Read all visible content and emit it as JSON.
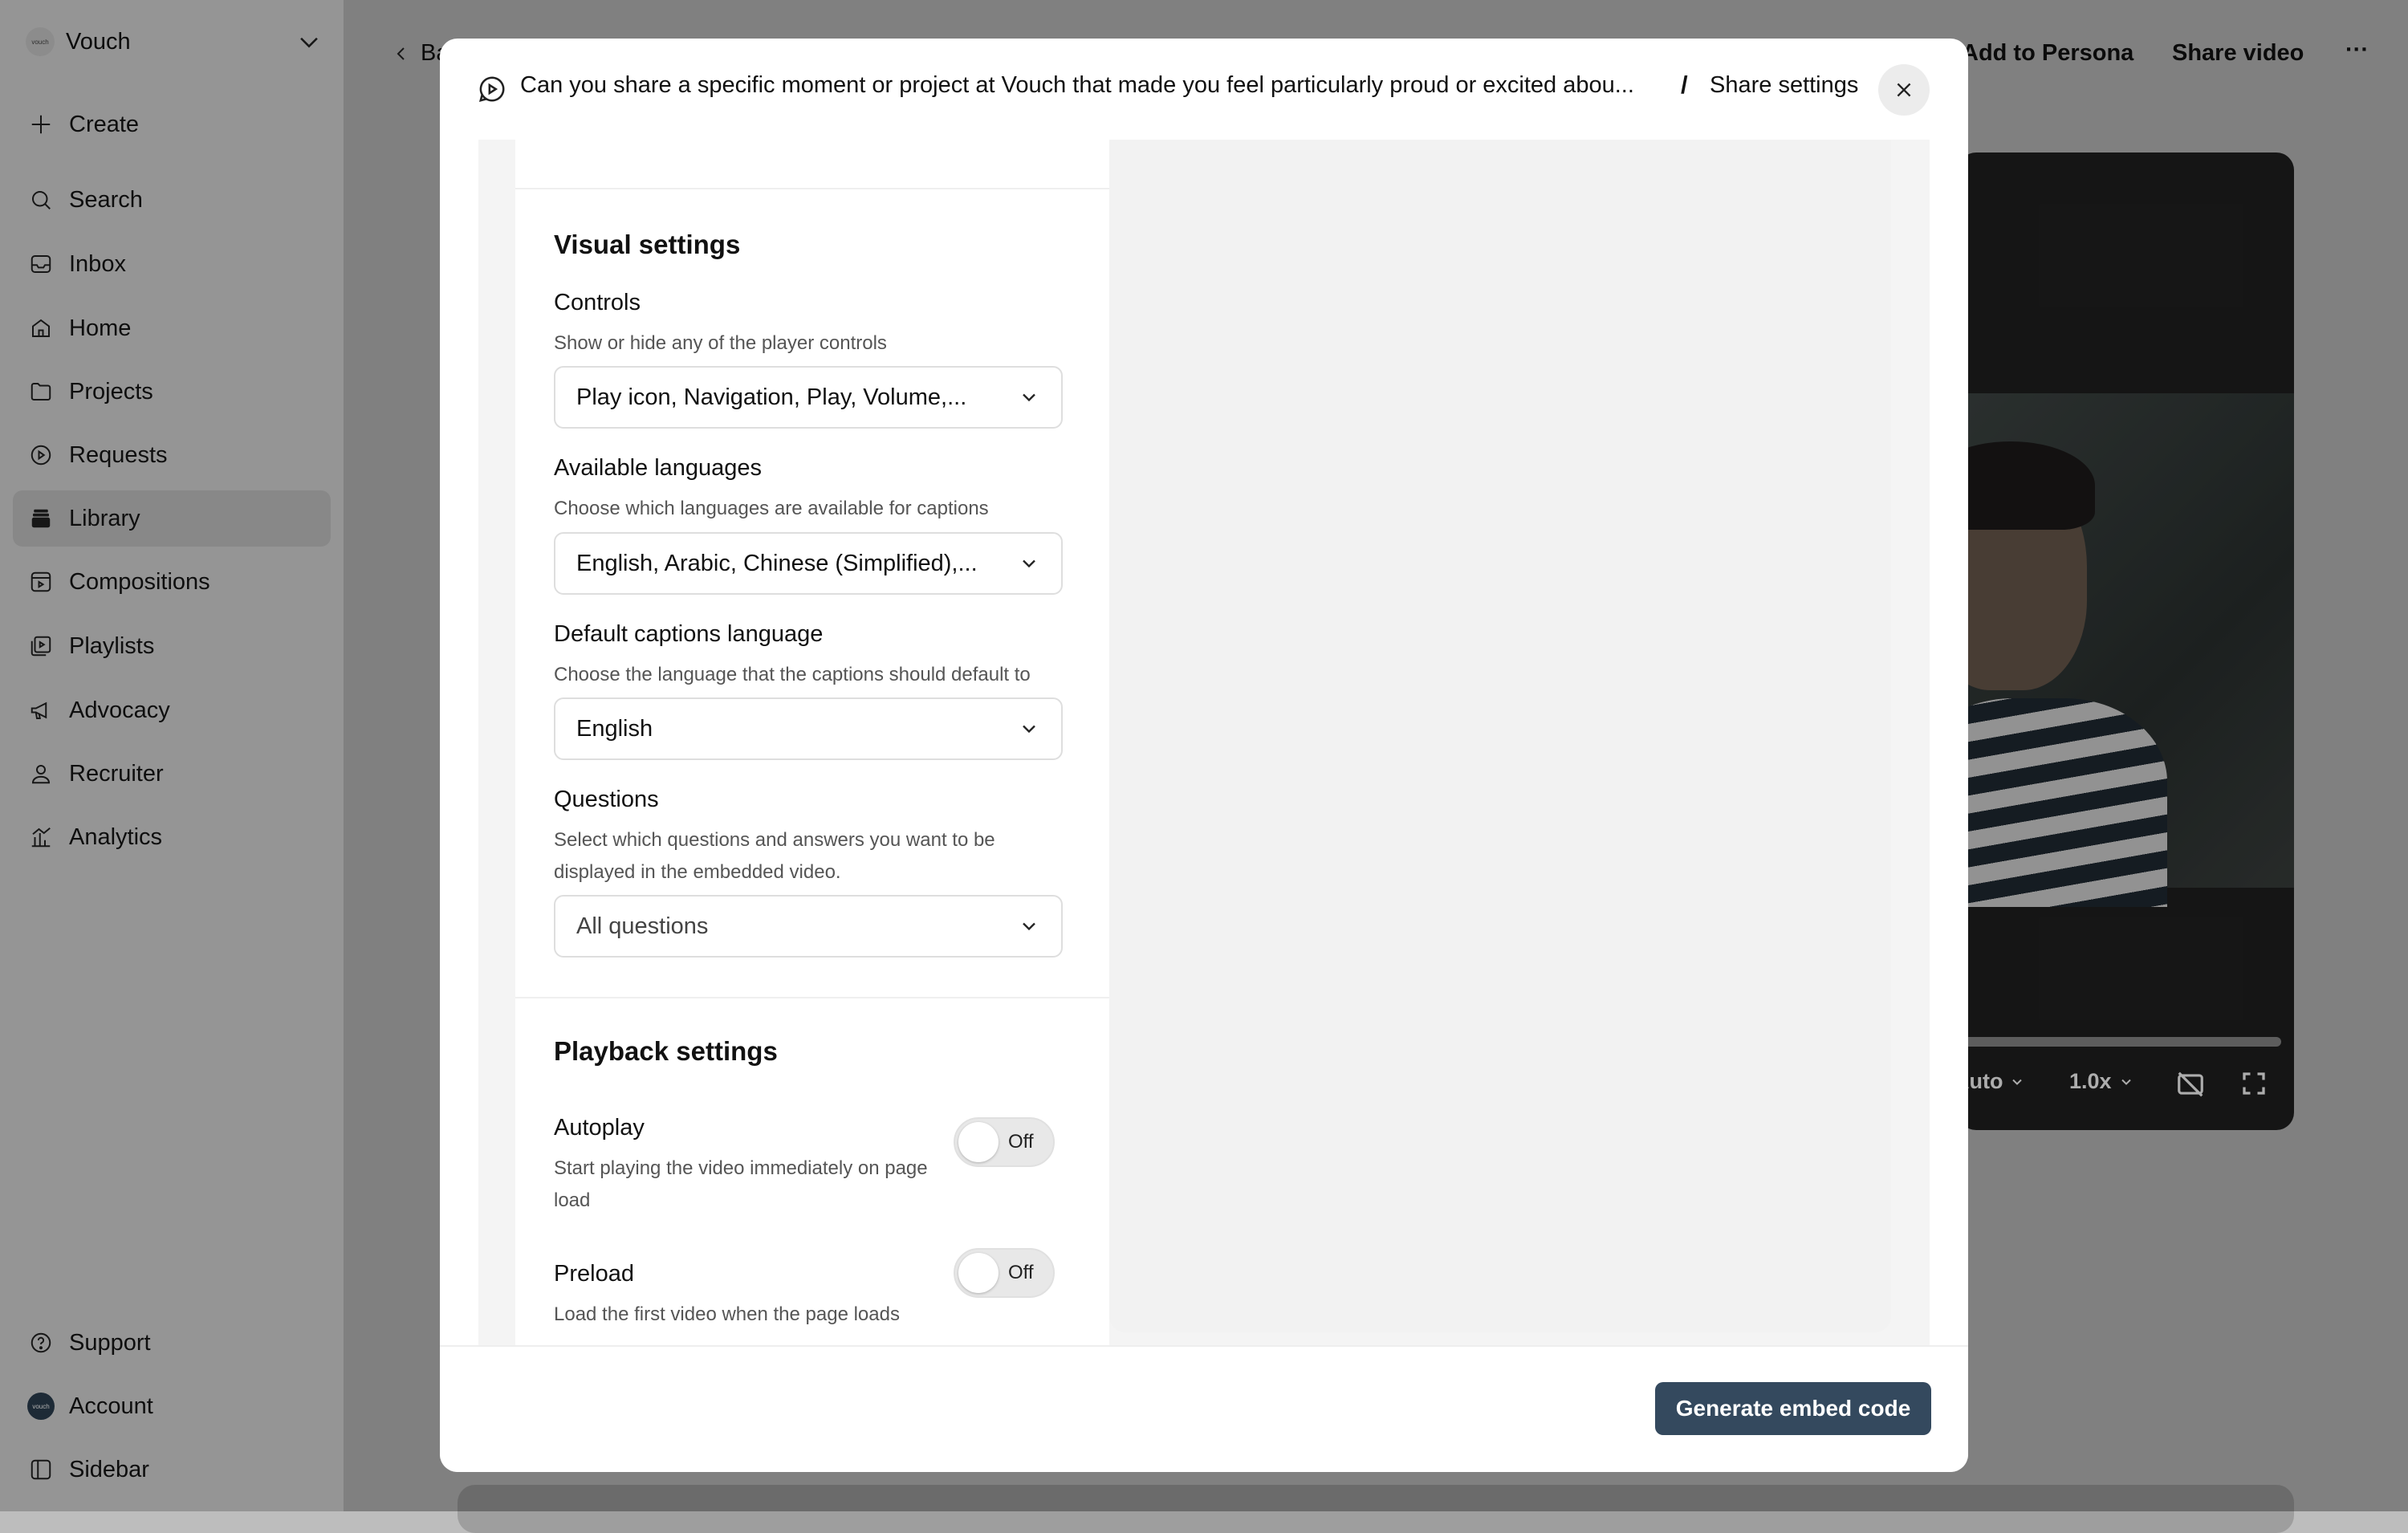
{
  "sidebar": {
    "workspace": {
      "name": "Vouch",
      "logo_text": "vouch"
    },
    "nav": [
      {
        "label": "Create",
        "icon": "plus-icon"
      },
      {
        "label": "Search",
        "icon": "search-icon"
      },
      {
        "label": "Inbox",
        "icon": "inbox-icon"
      },
      {
        "label": "Home",
        "icon": "home-icon"
      },
      {
        "label": "Projects",
        "icon": "folder-icon"
      },
      {
        "label": "Requests",
        "icon": "request-icon"
      },
      {
        "label": "Library",
        "icon": "library-icon",
        "active": true
      },
      {
        "label": "Compositions",
        "icon": "compositions-icon"
      },
      {
        "label": "Playlists",
        "icon": "playlists-icon"
      },
      {
        "label": "Advocacy",
        "icon": "megaphone-icon"
      },
      {
        "label": "Recruiter",
        "icon": "recruiter-icon"
      },
      {
        "label": "Analytics",
        "icon": "analytics-icon"
      }
    ],
    "bottom": [
      {
        "label": "Support",
        "icon": "help-icon"
      },
      {
        "label": "Account",
        "icon": "avatar"
      },
      {
        "label": "Sidebar",
        "icon": "sidebar-icon"
      }
    ]
  },
  "topbar": {
    "back_label": "Ba",
    "add_to_persona": "Add to Persona",
    "share_video": "Share video",
    "more": "···"
  },
  "video_player": {
    "quality": "Auto",
    "speed": "1.0x"
  },
  "modal": {
    "question": "Can you share a specific moment or project at Vouch that made you feel particularly proud or excited abou...",
    "separator": "/",
    "breadcrumb": "Share settings",
    "visual_settings": {
      "title": "Visual settings",
      "controls": {
        "label": "Controls",
        "help": "Show or hide any of the player controls",
        "value": "Play icon, Navigation, Play, Volume,..."
      },
      "languages": {
        "label": "Available languages",
        "help": "Choose which languages are available for captions",
        "value": "English, Arabic, Chinese (Simplified),..."
      },
      "default_captions": {
        "label": "Default captions language",
        "help": "Choose the language that the captions should default to",
        "value": "English"
      },
      "questions": {
        "label": "Questions",
        "help": "Select which questions and answers you want to be displayed in the embedded video.",
        "value": "All questions"
      }
    },
    "playback_settings": {
      "title": "Playback settings",
      "autoplay": {
        "label": "Autoplay",
        "help": "Start playing the video immediately on page load",
        "state": "Off"
      },
      "preload": {
        "label": "Preload",
        "help": "Load the first video when the page loads",
        "state": "Off"
      }
    },
    "generate_button": "Generate embed code"
  },
  "colors": {
    "primary_button": "#34495e",
    "sidebar_bg": "#dcdcdc",
    "overlay": "rgba(0,0,0,0.32)"
  }
}
